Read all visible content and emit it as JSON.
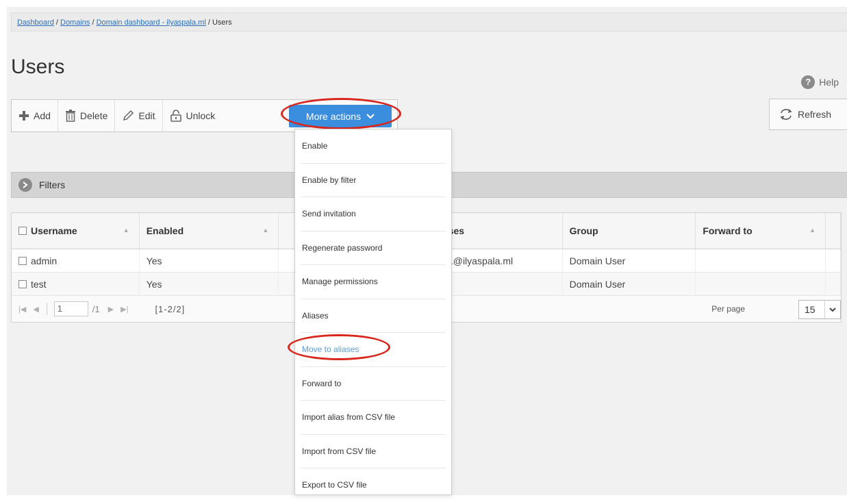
{
  "breadcrumb": {
    "items": [
      "Dashboard",
      "Domains",
      "Domain dashboard - ilyaspala.ml"
    ],
    "current": "Users",
    "separator": " / "
  },
  "page": {
    "title": "Users",
    "help_label": "Help"
  },
  "toolbar": {
    "add_label": "Add",
    "delete_label": "Delete",
    "edit_label": "Edit",
    "unlock_label": "Unlock",
    "more_actions_label": "More actions",
    "refresh_label": "Refresh"
  },
  "filters": {
    "label": "Filters"
  },
  "table": {
    "columns": [
      "Username",
      "Enabled",
      "",
      "ases",
      "Group",
      "Forward to"
    ],
    "rows": [
      {
        "username": "admin",
        "enabled": "Yes",
        "aliases": "s1@ilyaspala.ml",
        "group": "Domain User",
        "forward": ""
      },
      {
        "username": "test",
        "enabled": "Yes",
        "aliases": "",
        "group": "Domain User",
        "forward": ""
      }
    ]
  },
  "pager": {
    "page": "1",
    "total": "/1",
    "range": "[1-2/2]",
    "per_page_label": "Per page",
    "per_page_value": "15"
  },
  "dropdown": {
    "items": [
      "Enable",
      "Enable by filter",
      "Send invitation",
      "Regenerate password",
      "Manage permissions",
      "Aliases",
      "Move to aliases",
      "Forward to",
      "Import alias from CSV file",
      "Import from CSV file",
      "Export to CSV file"
    ],
    "highlighted": "Move to aliases"
  },
  "colors": {
    "accent": "#3b8ede",
    "annotation": "#d9261c",
    "link": "#2a6ebb"
  },
  "icons": [
    "plus-icon",
    "trash-icon",
    "pencil-icon",
    "unlock-icon",
    "chevron-down-icon",
    "refresh-icon",
    "help-icon",
    "filter-toggle-icon"
  ]
}
